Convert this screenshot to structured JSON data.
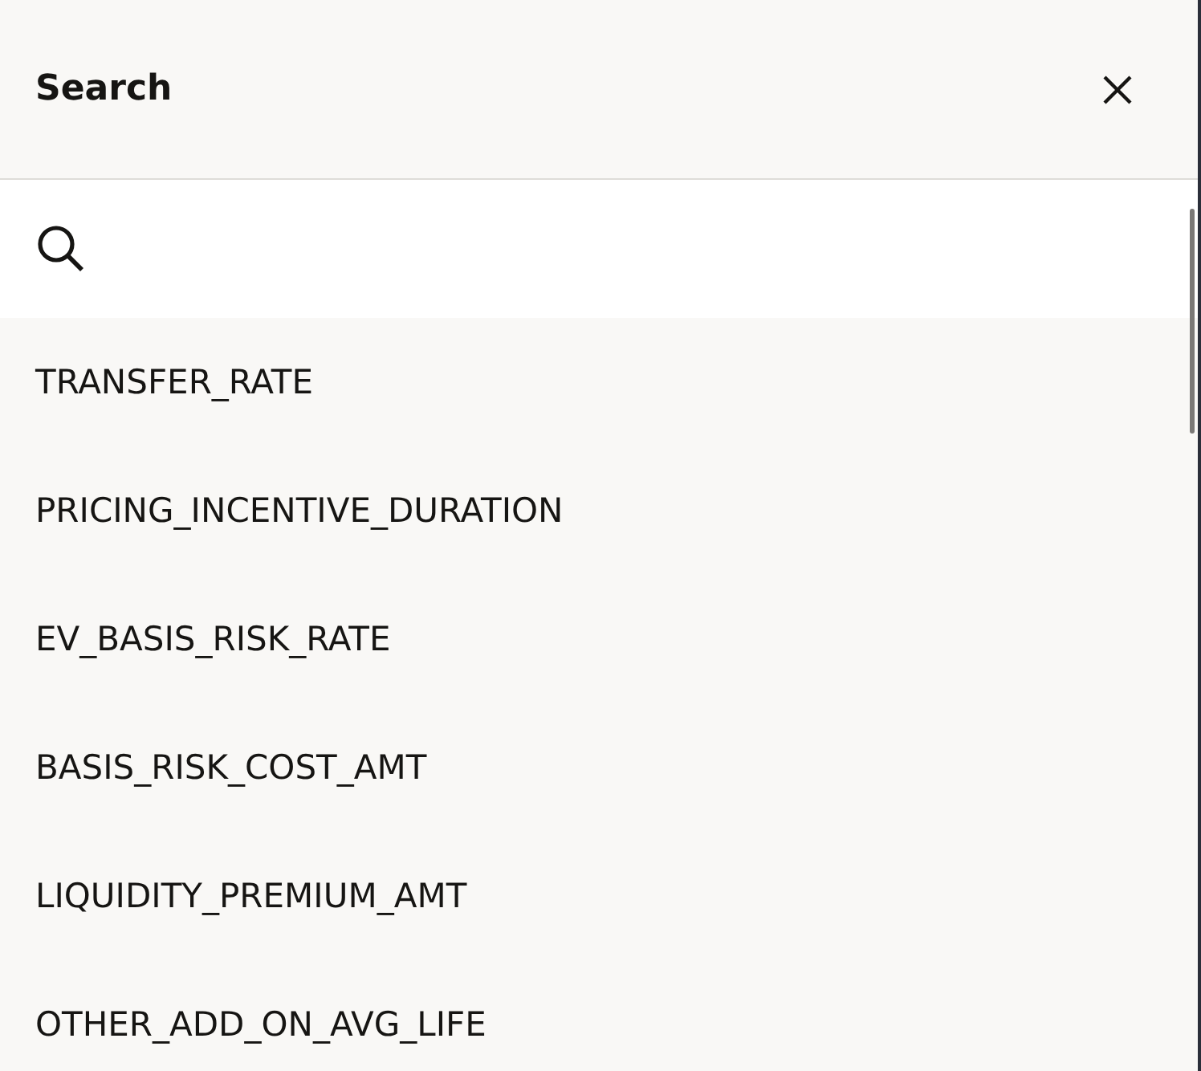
{
  "header": {
    "title": "Search"
  },
  "results": [
    {
      "label": "TRANSFER_RATE"
    },
    {
      "label": "PRICING_INCENTIVE_DURATION"
    },
    {
      "label": "EV_BASIS_RISK_RATE"
    },
    {
      "label": "BASIS_RISK_COST_AMT"
    },
    {
      "label": "LIQUIDITY_PREMIUM_AMT"
    },
    {
      "label": "OTHER_ADD_ON_AVG_LIFE"
    }
  ]
}
